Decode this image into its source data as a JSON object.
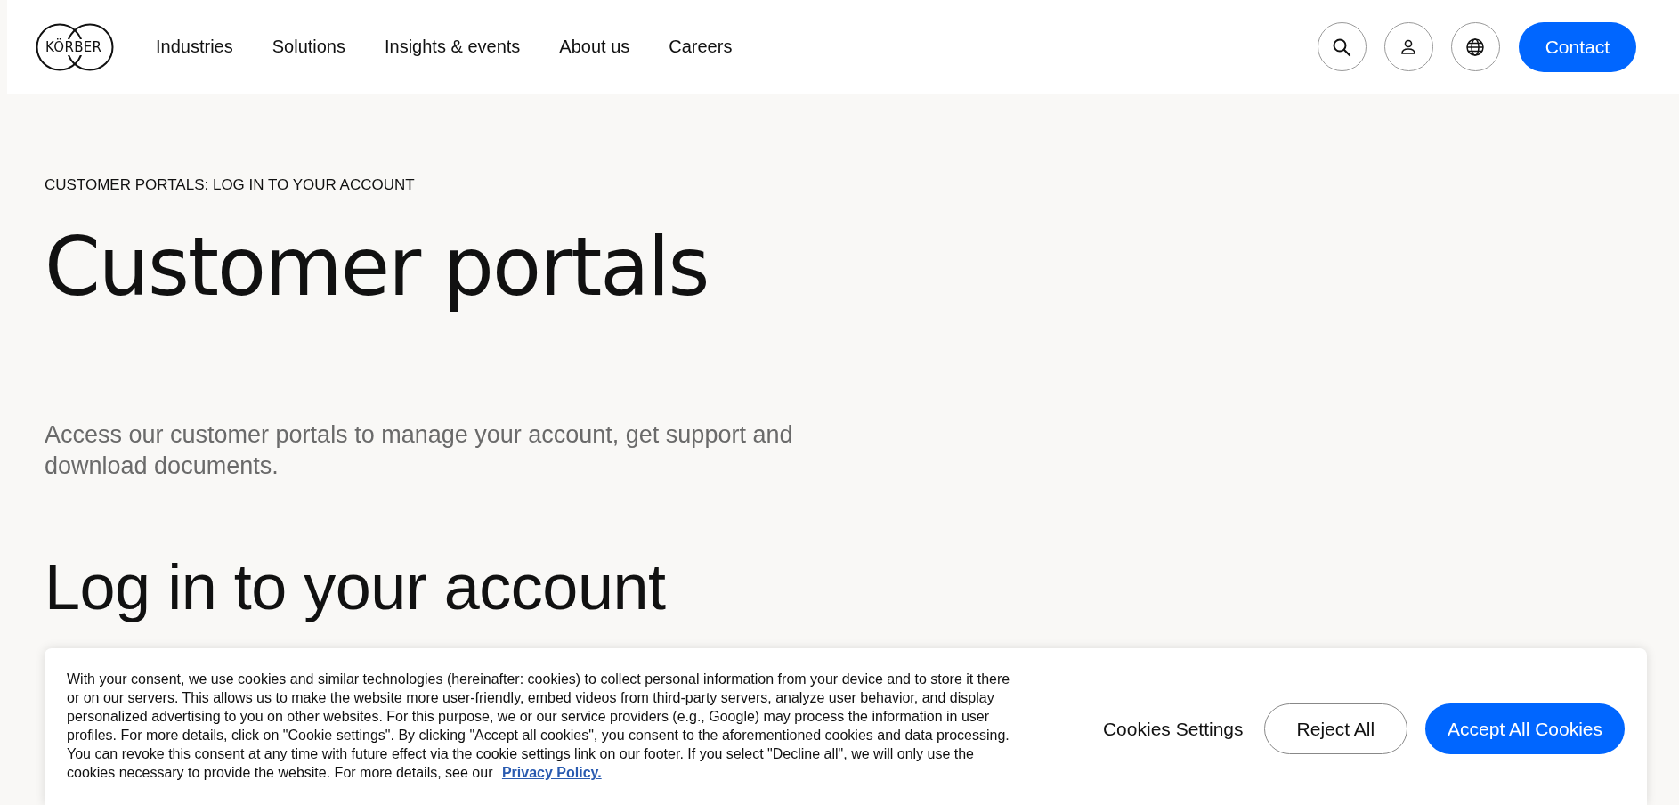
{
  "header": {
    "logo": "KÖRBER",
    "nav": [
      "Industries",
      "Solutions",
      "Insights & events",
      "About us",
      "Careers"
    ],
    "icon_buttons": [
      {
        "kind": "search"
      },
      {
        "kind": "account"
      },
      {
        "kind": "language"
      }
    ],
    "contact": "Contact"
  },
  "breadcrumb": "CUSTOMER PORTALS: LOG IN TO YOUR ACCOUNT",
  "title": "Customer portals",
  "intro": "Access our customer portals to manage your account, get support and download documents.",
  "section_heading": "Log in to your account",
  "cookie_banner": {
    "text": "With your consent, we use cookies and similar technologies (hereinafter: cookies) to collect personal information from your device and to store it there or on our servers. This allows us to make the website more user-friendly, embed videos from third-party servers, analyze user behavior, and display personalized advertising to you on other websites. For this purpose, we or our service providers (e.g., Google) may process the information in user profiles. For more details, click on \"Cookie settings\". By clicking \"Accept all cookies\", you consent to the aforementioned cookies and data processing. You can revoke this consent at any time with future effect via the cookie settings link on our footer. If you select \"Decline all\", we will only use the cookies necessary to provide the website. For more details, see our",
    "link": "Privacy Policy.",
    "buttons": [
      {
        "label": "Cookies Settings",
        "kind": "text"
      },
      {
        "label": "Reject All",
        "kind": "outline"
      },
      {
        "label": "Accept All Cookies",
        "kind": "primary"
      }
    ]
  }
}
